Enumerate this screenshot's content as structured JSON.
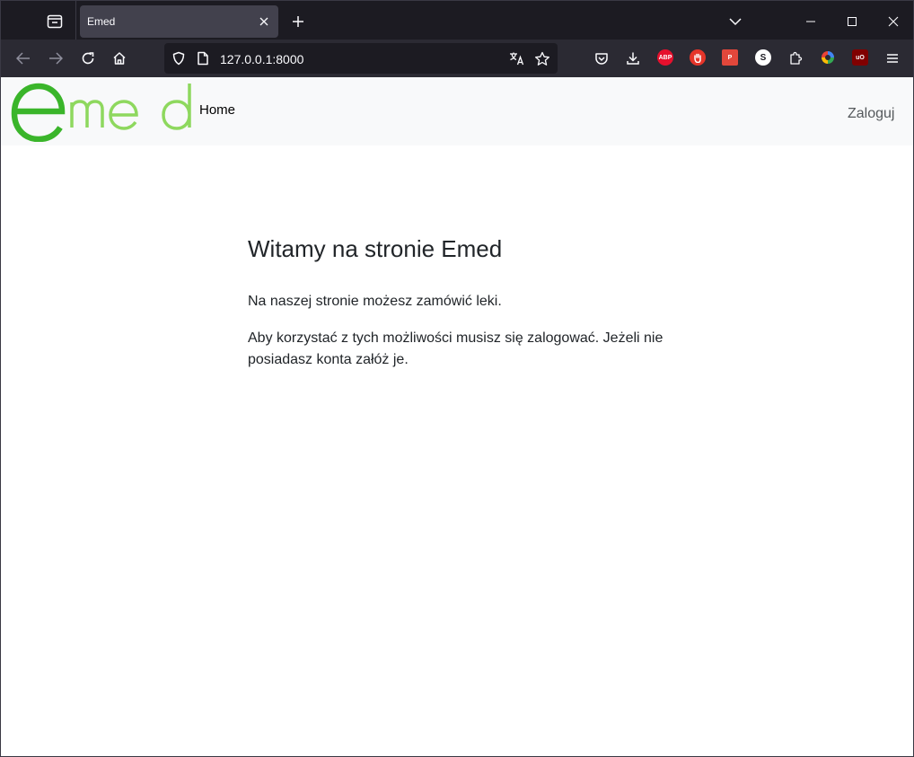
{
  "browser": {
    "tab_title": "Emed",
    "url": "127.0.0.1:8000",
    "extensions": [
      {
        "name": "adblock-plus",
        "label": "ABP",
        "color": "#e6102d"
      },
      {
        "name": "stop-hand",
        "label": "",
        "color": "#e5352a"
      },
      {
        "name": "p-ext",
        "label": "P",
        "color": "#e2473b"
      },
      {
        "name": "s-ext",
        "label": "S",
        "color": "#ffffff"
      },
      {
        "name": "ublock-origin",
        "label": "uO",
        "color": "#800000"
      }
    ]
  },
  "site": {
    "logo_text": "emed",
    "nav": {
      "home": "Home",
      "login": "Zaloguj"
    },
    "heading": "Witamy na stronie Emed",
    "paragraphs": [
      "Na naszej stronie możesz zamówić leki.",
      "Aby korzystać z tych możliwości musisz się zalogować. Jeżeli nie posiadasz konta załóż je."
    ],
    "colors": {
      "logo_dark_green": "#3ab52a",
      "logo_light_green": "#8ed85e",
      "nav_bg": "#f8f9fa"
    }
  }
}
